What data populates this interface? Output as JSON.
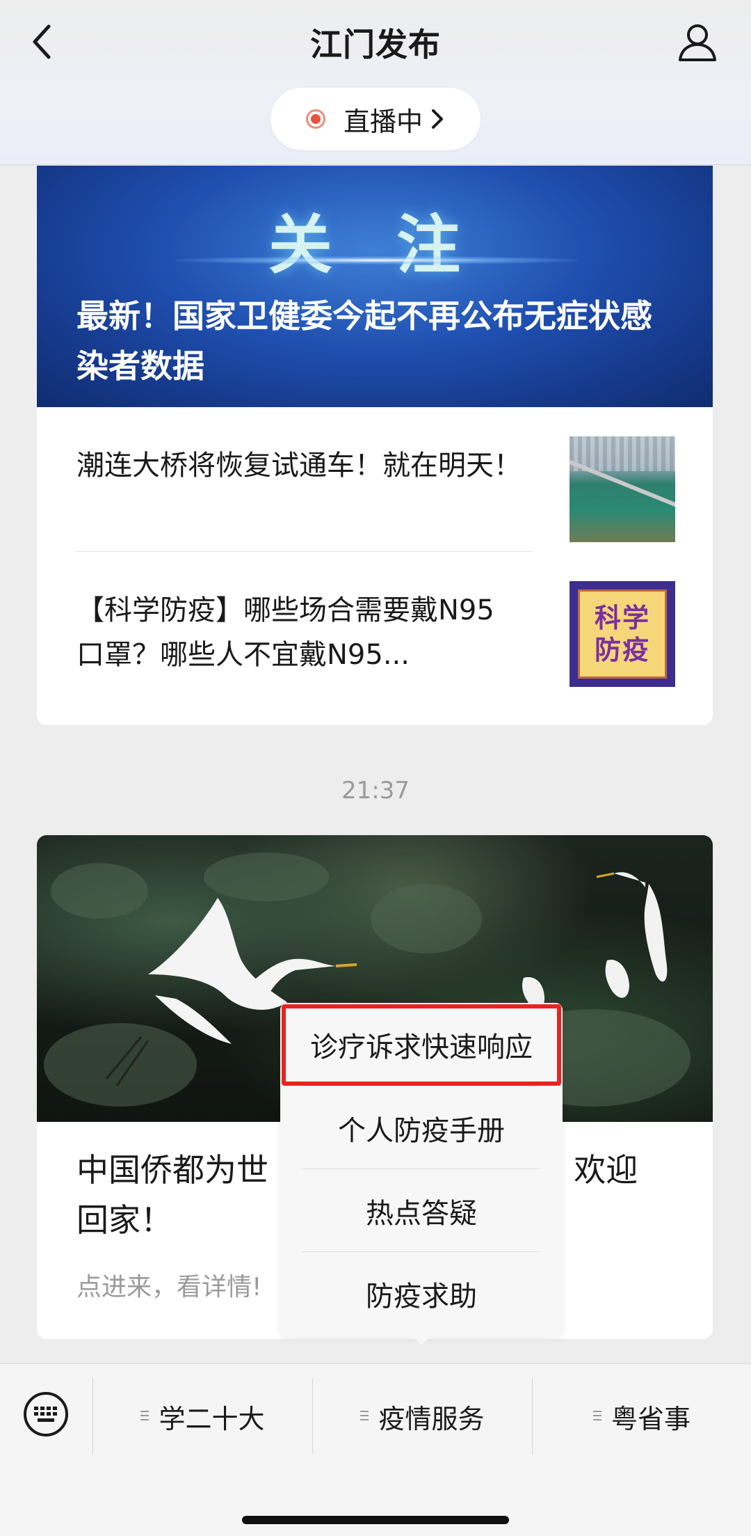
{
  "header": {
    "title": "江门发布",
    "live_label": "直播中"
  },
  "card1": {
    "banner_tag": "关 注",
    "banner_headline": "最新！国家卫健委今起不再公布无症状感染者数据",
    "news": [
      {
        "text": "潮连大桥将恢复试通车！就在明天！"
      },
      {
        "text": "【科学防疫】哪些场合需要戴N95口罩？哪些人不宜戴N95..."
      }
    ],
    "thumb2_lines": [
      "科学",
      "防疫"
    ]
  },
  "timestamp": "21:37",
  "card2": {
    "title": "中国侨都为世 欢迎回家！",
    "title_left": "中国侨都为世",
    "title_right": "欢迎",
    "title_line2": "回家！",
    "subtitle": "点进来，看详情!"
  },
  "popup_menu": {
    "items": [
      {
        "label": "诊疗诉求快速响应",
        "highlighted": true
      },
      {
        "label": "个人防疫手册"
      },
      {
        "label": "热点答疑"
      },
      {
        "label": "防疫求助"
      }
    ],
    "highlight_color": "#e8231f"
  },
  "bottom_menu": {
    "items": [
      {
        "label": "学二十大"
      },
      {
        "label": "疫情服务"
      },
      {
        "label": "粤省事"
      }
    ]
  },
  "icons": {
    "back": "chevron-left-icon",
    "profile": "user-icon",
    "keyboard": "keyboard-icon",
    "live": "live-dot-icon"
  }
}
